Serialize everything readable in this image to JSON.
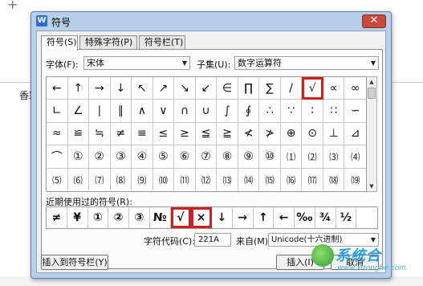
{
  "background": {
    "plus": "+",
    "text": "香彩"
  },
  "dialog": {
    "app_icon": "W",
    "title": "符号",
    "close": "✕"
  },
  "tabs": [
    {
      "label": "符号(S)",
      "active": true
    },
    {
      "label": "特殊字符(P)",
      "active": false
    },
    {
      "label": "符号栏(T)",
      "active": false
    }
  ],
  "font": {
    "label": "字体(F):",
    "value": "宋体"
  },
  "subset": {
    "label": "子集(U):",
    "value": "数字运算符"
  },
  "symbol_grid": [
    "←",
    "↑",
    "→",
    "↓",
    "↖",
    "↗",
    "↘",
    "↙",
    "∈",
    "∏",
    "∑",
    "/",
    "√",
    "∝",
    "∞",
    "∟",
    "∠",
    "∣",
    "∥",
    "∧",
    "∨",
    "∩",
    "∪",
    "∫",
    "∮",
    "∴",
    "∵",
    "∶",
    "∷",
    "∽",
    "≈",
    "≌",
    "≒",
    "≠",
    "≡",
    "≤",
    "≥",
    "≦",
    "≧",
    "≮",
    "≯",
    "⊕",
    "⊙",
    "⊥",
    "⊿",
    "⌒",
    "①",
    "②",
    "③",
    "④",
    "⑤",
    "⑥",
    "⑦",
    "⑧",
    "⑨",
    "⑩",
    "⑴",
    "⑵",
    "⑶",
    "⑷",
    "⑸",
    "⑹",
    "⑺",
    "⑻",
    "⑼",
    "⑽",
    "⑾",
    "⑿",
    "⒀",
    "⒁",
    "⒂",
    "⒃",
    "⒄",
    "⒅",
    "⒆"
  ],
  "selected_symbol_index": 12,
  "recent": {
    "label": "近期使用过的符号(R):",
    "items": [
      "≠",
      "¥",
      "①",
      "②",
      "③",
      "№",
      "√",
      "×",
      "↓",
      "→",
      "↑",
      "←",
      "‰",
      "¾",
      "½",
      ""
    ],
    "selected_indices": [
      6,
      7
    ]
  },
  "char_code": {
    "label": "字符代码(C):",
    "value": "221A"
  },
  "from": {
    "label": "来自(M):",
    "value": "Unicode(十六进制)"
  },
  "buttons": {
    "insert_to_bar": "插入到符号栏(Y)",
    "insert": "插入(I)",
    "cancel": "取消"
  },
  "watermark": {
    "text": "系统合",
    "url": "www.xitonghe.com"
  }
}
